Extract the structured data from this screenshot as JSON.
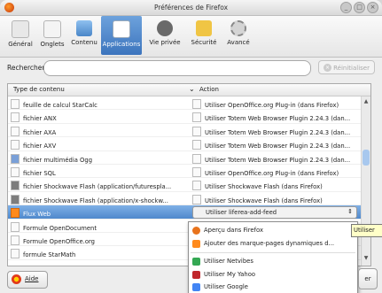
{
  "window": {
    "title": "Préférences de Firefox",
    "controls": [
      "_",
      "□",
      "×"
    ]
  },
  "toolbar": {
    "tabs": [
      {
        "label": "Général",
        "icon": "switch-icon"
      },
      {
        "label": "Onglets",
        "icon": "tabs-icon"
      },
      {
        "label": "Contenu",
        "icon": "content-icon"
      },
      {
        "label": "Applications",
        "icon": "applications-icon",
        "active": true
      },
      {
        "label": "Vie privée",
        "icon": "mask-icon"
      },
      {
        "label": "Sécurité",
        "icon": "security-icon"
      },
      {
        "label": "Avancé",
        "icon": "gear-icon"
      }
    ]
  },
  "search": {
    "label": "Rechercher :",
    "value": "",
    "clear_label": "Réinitialiser"
  },
  "table": {
    "col1_header": "Type de contenu",
    "col2_header": "Action",
    "rows": [
      {
        "type": "feuille de calcul StarCalc",
        "action": "Utiliser OpenOffice.org Plug-in (dans Firefox)"
      },
      {
        "type": "fichier ANX",
        "action": "Utiliser Totem Web Browser Plugin 2.24.3 (dan..."
      },
      {
        "type": "fichier AXA",
        "action": "Utiliser Totem Web Browser Plugin 2.24.3 (dan..."
      },
      {
        "type": "fichier AXV",
        "action": "Utiliser Totem Web Browser Plugin 2.24.3 (dan..."
      },
      {
        "type": "fichier multimédia Ogg",
        "action": "Utiliser Totem Web Browser Plugin 2.24.3 (dan..."
      },
      {
        "type": "fichier SQL",
        "action": "Utiliser OpenOffice.org Plug-in (dans Firefox)"
      },
      {
        "type": "fichier Shockwave Flash (application/futurespla...",
        "action": "Utiliser Shockwave Flash (dans Firefox)"
      },
      {
        "type": "fichier Shockwave Flash (application/x-shockw...",
        "action": "Utiliser Shockwave Flash (dans Firefox)"
      },
      {
        "type": "Flux Web",
        "action": "Utiliser liferea-add-feed",
        "selected": true
      },
      {
        "type": "Formule OpenDocument",
        "action": ""
      },
      {
        "type": "Formule OpenOffice.org",
        "action": ""
      },
      {
        "type": "formule StarMath",
        "action": ""
      },
      {
        "type": "",
        "action": ""
      }
    ]
  },
  "popup": {
    "items": [
      {
        "label": "Aperçu dans Firefox",
        "icon": "firefox-icon",
        "color": "#e8731c"
      },
      {
        "label": "Ajouter des marque-pages dynamiques d...",
        "icon": "livemark-icon",
        "color": "#ff8a1d"
      },
      {
        "label": "Utiliser Netvibes",
        "icon": "netvibes-icon",
        "color": "#34a853"
      },
      {
        "label": "Utiliser My Yahoo",
        "icon": "yahoo-icon",
        "color": "#c0262b"
      },
      {
        "label": "Utiliser Google",
        "icon": "google-icon",
        "color": "#4285f4"
      }
    ],
    "tooltip": "Utiliser"
  },
  "footer": {
    "help_label": "Aide",
    "close_label": "er"
  },
  "colors": {
    "selection": "#4f88cc",
    "active_tab": "#3c74bd"
  }
}
